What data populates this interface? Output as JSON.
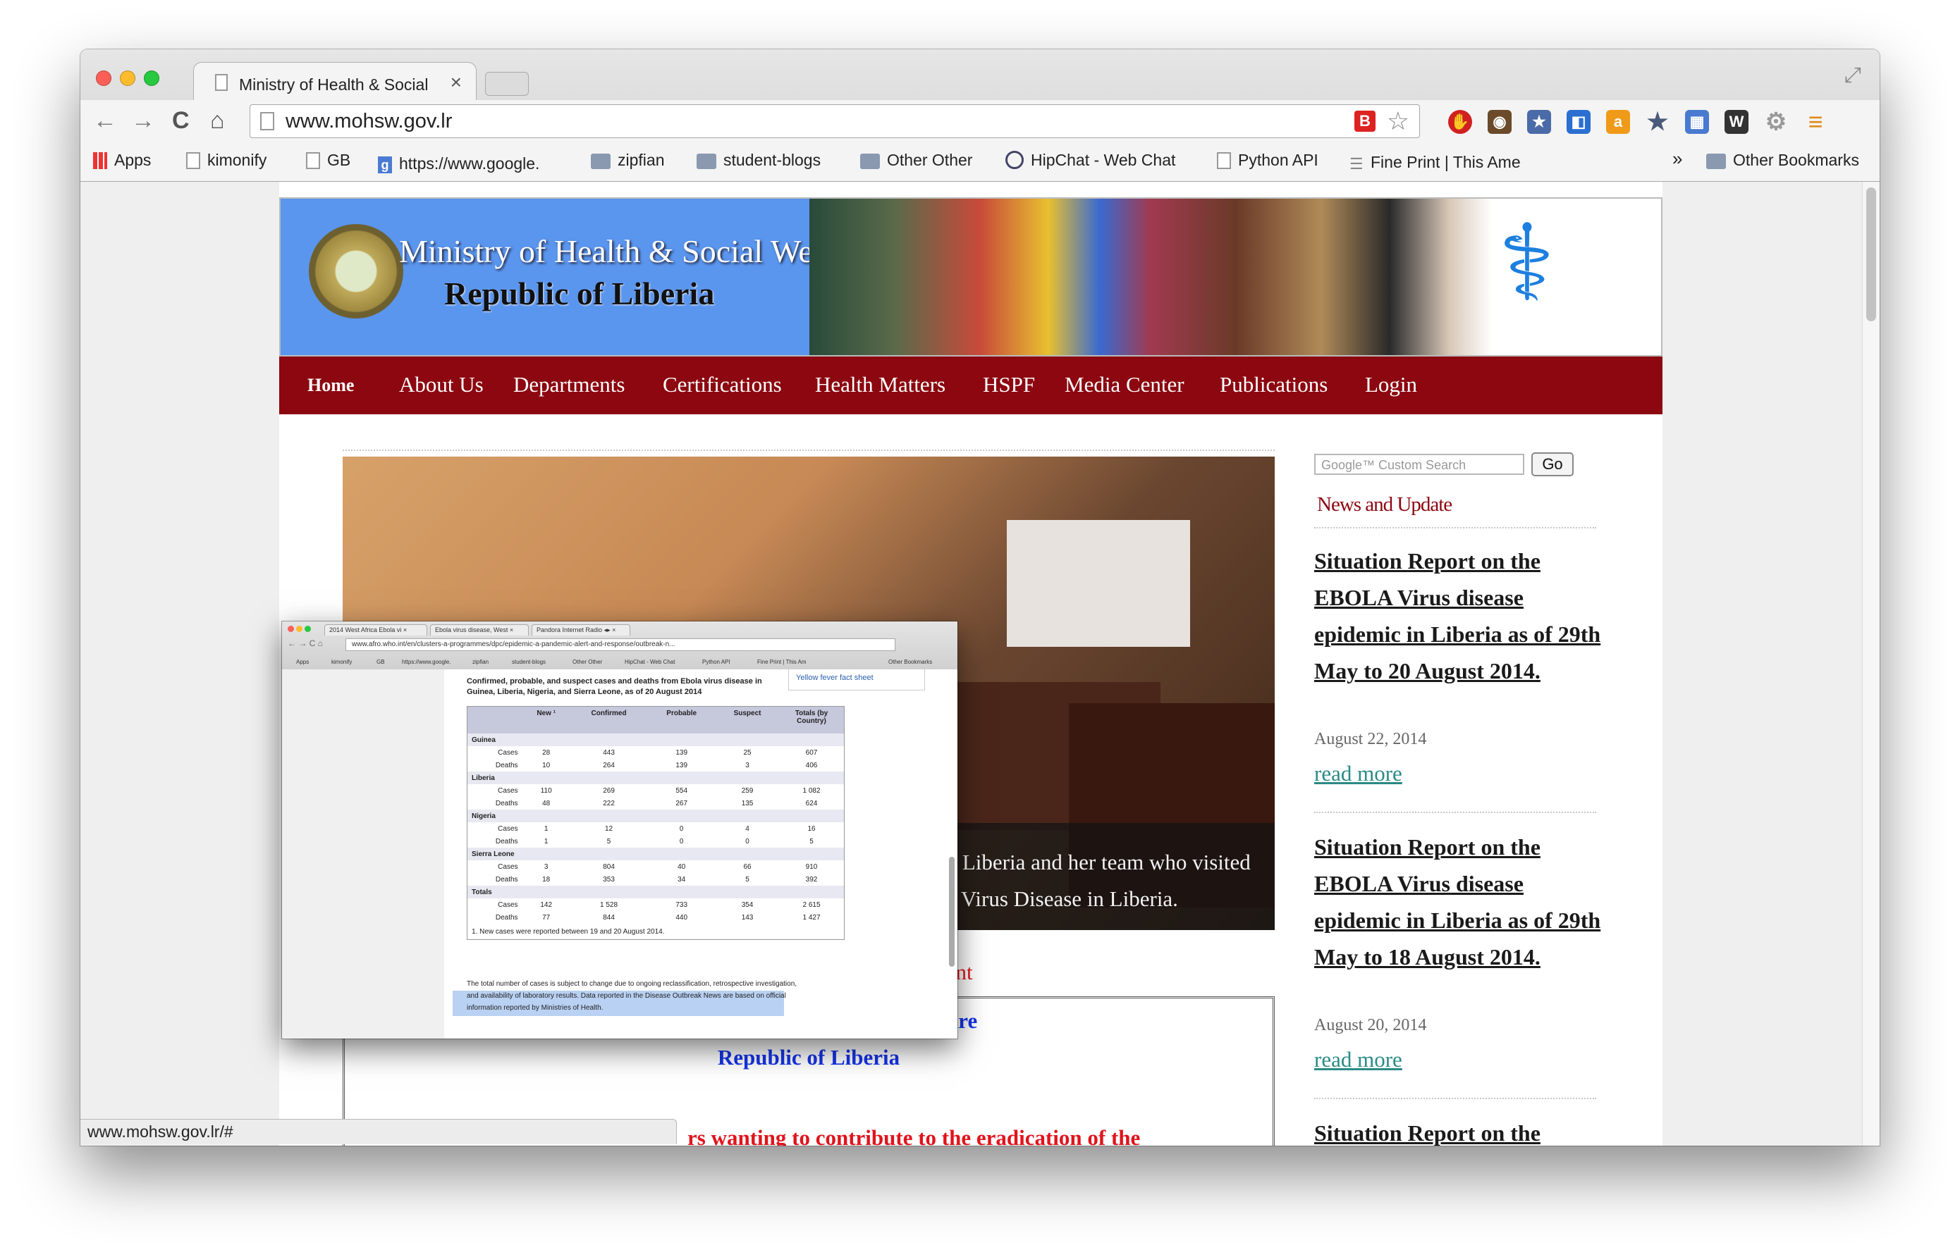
{
  "browser": {
    "tab_title": "Ministry of Health & Social",
    "tab_close": "×",
    "url": "www.mohsw.gov.lr",
    "back_glyph": "←",
    "forward_glyph": "→",
    "reload_glyph": "C",
    "home_glyph": "⌂",
    "star_glyph": "☆",
    "bookmarks": [
      {
        "label": "Apps",
        "icon": "apps-grid-icon"
      },
      {
        "label": "kimonify",
        "icon": "page-icon"
      },
      {
        "label": "GB",
        "icon": "page-icon"
      },
      {
        "label": "https://www.google.",
        "icon": "google-icon"
      },
      {
        "label": "zipfian",
        "icon": "folder-icon"
      },
      {
        "label": "student-blogs",
        "icon": "folder-icon"
      },
      {
        "label": "Other Other",
        "icon": "folder-icon"
      },
      {
        "label": "HipChat - Web Chat",
        "icon": "chat-icon"
      },
      {
        "label": "Python API",
        "icon": "page-icon"
      },
      {
        "label": "Fine Print | This Ame",
        "icon": "rss-icon"
      }
    ],
    "overflow": "»",
    "other_bookmarks": "Other Bookmarks",
    "status_url": "www.mohsw.gov.lr/#"
  },
  "site": {
    "banner_title": "Ministry of Health & Social Welfare",
    "banner_subtitle": "Republic of Liberia",
    "menu": [
      "Home",
      "About Us",
      "Departments",
      "Certifications",
      "Health Matters",
      "HSPF",
      "Media Center",
      "Publications",
      "Login"
    ],
    "slide_caption": "Health Minister, Dr. Walter T. Gwenigale, welcomes the president of Liberia and her team who visited the Ministry to discuss remedies on the recent outbreak on the Ebola Virus Disease in Liberia.",
    "account_title": "MOHSW EBOLA Response Account",
    "account_line1": "Ministry of Health & Social Welfare",
    "account_line2": "Republic of Liberia",
    "account_line3": "rs wanting to contribute to the eradication of the",
    "search_placeholder": "Google™ Custom Search",
    "search_button": "Go",
    "news_heading": "News and Update",
    "news": [
      {
        "title": "Situation Report on the EBOLA Virus disease epidemic in Liberia as of 29th May to 20 August 2014.",
        "date": "August 22, 2014",
        "more": "read more"
      },
      {
        "title": "Situation Report on the EBOLA Virus disease epidemic in Liberia as of 29th May to 18 August 2014.",
        "date": "August 20, 2014",
        "more": "read more"
      },
      {
        "title": "Situation Report on the",
        "date": "",
        "more": ""
      }
    ]
  },
  "overlay": {
    "tabs": [
      "2014 West Africa Ebola vi ×",
      "Ebola virus disease, West ×",
      "Pandora Internet Radio ◂▸ ×"
    ],
    "url": "www.afro.who.int/en/clusters-a-programmes/dpc/epidemic-a-pandemic-alert-and-response/outbreak-n...",
    "bookmarks": [
      "Apps",
      "kimonify",
      "GB",
      "https://www.google.",
      "zipfian",
      "student-blogs",
      "Other Other",
      "HipChat - Web Chat",
      "Python API",
      "Fine Print | This Am",
      "Other Bookmarks"
    ],
    "side_link": "Yellow fever fact sheet",
    "heading": "Confirmed, probable, and suspect cases and deaths from Ebola virus disease in Guinea, Liberia, Nigeria, and Sierra Leone, as of 20 August 2014",
    "columns": [
      "",
      "New ¹",
      "Confirmed",
      "Probable",
      "Suspect",
      "Totals (by Country)"
    ],
    "groups": [
      {
        "name": "Guinea",
        "rows": [
          [
            "Cases",
            "28",
            "443",
            "139",
            "25",
            "607"
          ],
          [
            "Deaths",
            "10",
            "264",
            "139",
            "3",
            "406"
          ]
        ]
      },
      {
        "name": "Liberia",
        "rows": [
          [
            "Cases",
            "110",
            "269",
            "554",
            "259",
            "1 082"
          ],
          [
            "Deaths",
            "48",
            "222",
            "267",
            "135",
            "624"
          ]
        ]
      },
      {
        "name": "Nigeria",
        "rows": [
          [
            "Cases",
            "1",
            "12",
            "0",
            "4",
            "16"
          ],
          [
            "Deaths",
            "1",
            "5",
            "0",
            "0",
            "5"
          ]
        ]
      },
      {
        "name": "Sierra Leone",
        "rows": [
          [
            "Cases",
            "3",
            "804",
            "40",
            "66",
            "910"
          ],
          [
            "Deaths",
            "18",
            "353",
            "34",
            "5",
            "392"
          ]
        ]
      },
      {
        "name": "Totals",
        "rows": [
          [
            "Cases",
            "142",
            "1 528",
            "733",
            "354",
            "2 615"
          ],
          [
            "Deaths",
            "77",
            "844",
            "440",
            "143",
            "1 427"
          ]
        ]
      }
    ],
    "footnote": "1. New cases were reported between 19 and 20 August 2014.",
    "footer_text": "The total number of cases is subject to change due to ongoing reclassification, retrospective investigation, and availability of laboratory results. Data reported in the Disease Outbreak News are based on official information reported by Ministries of Health."
  },
  "colors": {
    "menu_bg": "#8c0710",
    "banner_bg": "#5a95ee",
    "link_teal": "#2a8a86",
    "alert_red": "#e0141c",
    "account_blue": "#1634e8"
  }
}
